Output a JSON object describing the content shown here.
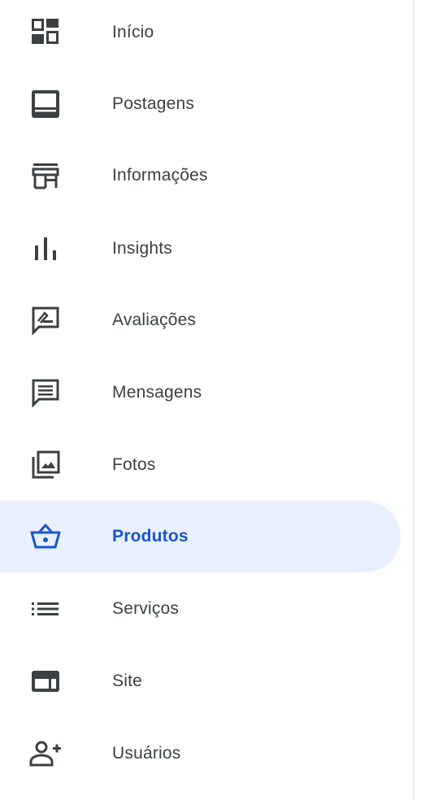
{
  "sidebar": {
    "accent_color": "#1a56c9",
    "active_bg_color": "#e8f0fe",
    "items": [
      {
        "label": "Início",
        "icon": "dashboard-icon"
      },
      {
        "label": "Postagens",
        "icon": "posts-icon"
      },
      {
        "label": "Informações",
        "icon": "storefront-icon"
      },
      {
        "label": "Insights",
        "icon": "bar-chart-icon"
      },
      {
        "label": "Avaliações",
        "icon": "rate-review-icon"
      },
      {
        "label": "Mensagens",
        "icon": "message-icon"
      },
      {
        "label": "Fotos",
        "icon": "photo-library-icon"
      },
      {
        "label": "Produtos",
        "icon": "basket-icon",
        "active": true
      },
      {
        "label": "Serviços",
        "icon": "list-icon"
      },
      {
        "label": "Site",
        "icon": "web-icon"
      },
      {
        "label": "Usuários",
        "icon": "person-add-icon"
      }
    ]
  }
}
